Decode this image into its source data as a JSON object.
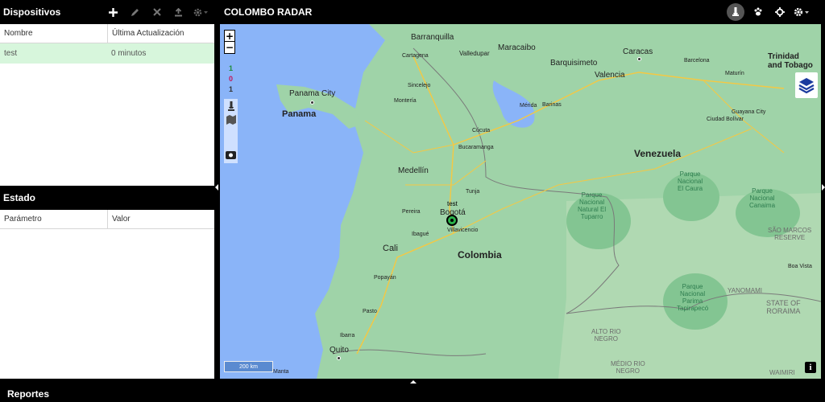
{
  "devices": {
    "title": "Dispositivos",
    "columns": [
      "Nombre",
      "Última Actualización"
    ],
    "rows": [
      {
        "name": "test",
        "updated": "0 minutos"
      }
    ]
  },
  "state": {
    "title": "Estado",
    "columns": [
      "Parámetro",
      "Valor"
    ]
  },
  "header": {
    "brand": "COLOMBO RADAR"
  },
  "map": {
    "zoom_in": "+",
    "zoom_out": "−",
    "counts": [
      "1",
      "0",
      "1"
    ],
    "count_colors": [
      "#1e8c3a",
      "#c2185b",
      "#333333"
    ],
    "scale": "200 km",
    "info": "i",
    "marker_label": "test",
    "labels": {
      "barranquilla": "Barranquilla",
      "cartagena": "Cartagena",
      "valledupar": "Valledupar",
      "maracaibo": "Maracaibo",
      "barquisimeto": "Barquisimeto",
      "caracas": "Caracas",
      "valencia": "Valencia",
      "barcelona": "Barcelona",
      "maturin": "Maturín",
      "trinidad": "Trinidad\nand Tobago",
      "panama_city": "Panama City",
      "panama": "Panama",
      "sincelejo": "Sincelejo",
      "monteria": "Montería",
      "merida": "Mérida",
      "barinas": "Barinas",
      "guayana": "Guayana City",
      "ciudad_bolivar": "Ciudad Bolívar",
      "cucuta": "Cúcuta",
      "bucaramanga": "Bucaramanga",
      "venezuela": "Venezuela",
      "medellin": "Medellín",
      "tunja": "Tunja",
      "pereira": "Pereira",
      "bogota": "Bogotá",
      "ibague": "Ibagué",
      "villavicencio": "Villavicencio",
      "cali": "Cali",
      "colombia": "Colombia",
      "popayan": "Popayán",
      "pasto": "Pasto",
      "ibarra": "Ibarra",
      "quito": "Quito",
      "manta": "Manta",
      "parque_elcaura": "Parque\nNacional\nEl Caura",
      "parque_canaima": "Parque\nNacional\nCanaima",
      "parque_tuparro": "Parque\nNacional\nNatural El\nTuparro",
      "parque_tapirapeco": "Parque\nNacional\nParima\nTapirapecó",
      "sao_marcos": "SÃO MARCOS\nRESERVE",
      "boa_vista": "Boa Vista",
      "yanomami": "YANOMAMI",
      "roraima": "STATE OF\nRORAIMA",
      "alto_rio_negro": "ALTO RIO\nNEGRO",
      "medio_rio_negro": "MÉDIO RIO\nNEGRO",
      "waimiri": "WAIMIRI"
    }
  },
  "reports": {
    "title": "Reportes"
  },
  "colors": {
    "water": "#8ab4f8",
    "land": "#9fd3a8",
    "selected_row": "#d7f6dc",
    "marker": "#2bb34a"
  }
}
